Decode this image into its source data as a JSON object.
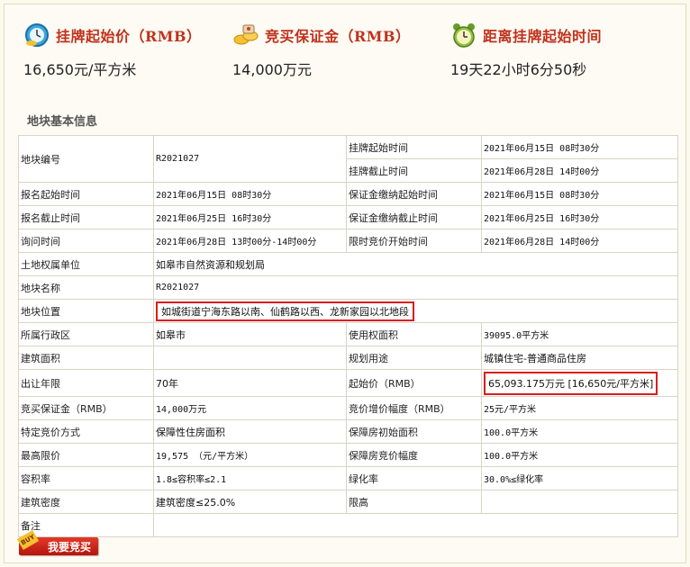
{
  "cards": {
    "start_price": {
      "label": "挂牌起始价（RMB）",
      "value": "16,650元/平方米",
      "icon": "clock-icon"
    },
    "deposit": {
      "label": "竞买保证金（RMB）",
      "value": "14,000万元",
      "icon": "coins-icon"
    },
    "countdown": {
      "label": "距离挂牌起始时间",
      "value": "19天22小时6分50秒",
      "icon": "alarm-clock-icon"
    }
  },
  "section_title": "地块基本信息",
  "table": {
    "parcel_no_label": "地块编号",
    "parcel_no": "R2021027",
    "list_start_label": "挂牌起始时间",
    "list_start": "2021年06月15日 08时30分",
    "list_end_label": "挂牌截止时间",
    "list_end": "2021年06月28日 14时00分",
    "reg_start_label": "报名起始时间",
    "reg_start": "2021年06月15日 08时30分",
    "dep_start_label": "保证金缴纳起始时间",
    "dep_start": "2021年06月15日 08时30分",
    "reg_end_label": "报名截止时间",
    "reg_end": "2021年06月25日 16时30分",
    "dep_end_label": "保证金缴纳截止时间",
    "dep_end": "2021年06月25日 16时30分",
    "inquiry_label": "询问时间",
    "inquiry": "2021年06月28日 13时00分-14时00分",
    "timed_label": "限时竞价开始时间",
    "timed": "2021年06月28日 14时00分",
    "owner_label": "土地权属单位",
    "owner": "如皋市自然资源和规划局",
    "name_label": "地块名称",
    "name": "R2021027",
    "location_label": "地块位置",
    "location": "如城街道宁海东路以南、仙鹤路以西、龙新家园以北地段",
    "district_label": "所属行政区",
    "district": "如皋市",
    "use_area_label": "使用权面积",
    "use_area": "39095.0平方米",
    "build_area_label": "建筑面积",
    "build_area": "",
    "plan_use_label": "规划用途",
    "plan_use": "城镇住宅-普通商品住房",
    "term_label": "出让年限",
    "term": "70年",
    "start_price_label": "起始价（RMB）",
    "start_price": "65,093.175万元 [16,650元/平方米]",
    "deposit_label": "竞买保证金（RMB）",
    "deposit": "14,000万元",
    "increment_label": "竞价增价幅度（RMB）",
    "increment": "25元/平方米",
    "method_label": "特定竞价方式",
    "method": "保障性住房面积",
    "sh_init_label": "保障房初始面积",
    "sh_init": "100.0平方米",
    "max_price_label": "最高限价",
    "max_price": "19,575 （元/平方米）",
    "sh_step_label": "保障房竞价幅度",
    "sh_step": "100.0平方米",
    "far_label": "容积率",
    "far": "1.8≤容积率≤2.1",
    "green_label": "绿化率",
    "green": "30.0%≤绿化率",
    "density_label": "建筑密度",
    "density": "建筑密度≤25.0%",
    "height_label": "限高",
    "height": "",
    "remark_label": "备注",
    "remark": ""
  },
  "bid_button": {
    "label": "我要竞买",
    "tag": "BUY"
  },
  "colors": {
    "accent": "#c0311c",
    "card_border": "#f2b12a",
    "card_bg": "#fff3c6",
    "highlight": "#d81e1e"
  }
}
